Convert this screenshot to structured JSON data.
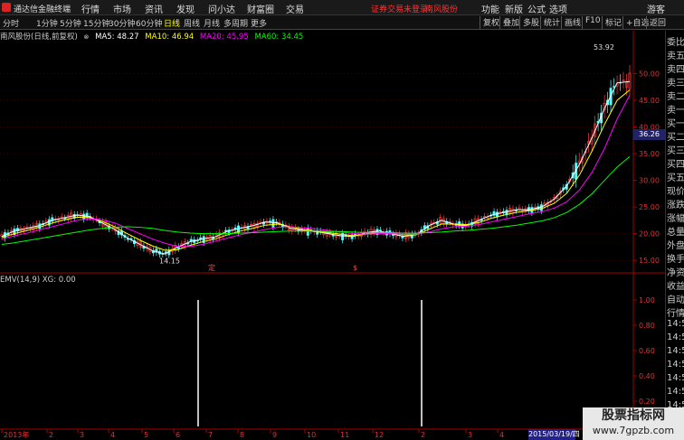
{
  "menubar": {
    "app_title": "通达信金融终端",
    "items": [
      "行情",
      "市场",
      "资讯",
      "发现",
      "问小达",
      "财富圈",
      "交易"
    ],
    "alert": "证券交易未登录",
    "stock_alert": "南风股份",
    "right_items": [
      "功能",
      "新版",
      "公式",
      "选项"
    ],
    "user": "游客"
  },
  "toolbar": {
    "periods": [
      "分时",
      "1分钟",
      "5分钟",
      "15分钟",
      "30分钟",
      "60分钟",
      "日线",
      "周线",
      "月线",
      "多周期",
      "更多"
    ],
    "active_period": "日线",
    "right_buttons": [
      "复权",
      "叠加",
      "多股",
      "统计",
      "画线",
      "F10",
      "标记",
      "+自选",
      "返回"
    ]
  },
  "chart_header": {
    "stock": "南风股份(日线,前复权)",
    "ma5": "MA5: 48.27",
    "ma10": "MA10: 46.94",
    "ma20": "MA20: 45.95",
    "ma60": "MA60: 34.45",
    "colors": {
      "ma5": "#ffffff",
      "ma10": "#ffff00",
      "ma20": "#ff00ff",
      "ma60": "#00ff00",
      "stock": "#cccccc"
    }
  },
  "emv_header": {
    "label": "EMV(14,9)",
    "xg": "XG: 0.00"
  },
  "right_panel": [
    "委比",
    "卖五",
    "卖四",
    "卖三",
    "卖二",
    "卖一",
    "买一",
    "买二",
    "买三",
    "买四",
    "买五",
    "现价",
    "涨跌",
    "涨幅",
    "总量",
    "外盘",
    "换手",
    "净资",
    "收益",
    "自动",
    "行情",
    "14:5(",
    "14:5(",
    "14:5(",
    "14:5(",
    "14:5(",
    "14:5(",
    "14:5(",
    "14:5("
  ],
  "price_axis_labels": [
    "50.00",
    "45.00",
    "40.00",
    "35.00",
    "30.00",
    "25.00",
    "20.00",
    "15.00"
  ],
  "emv_axis_labels": [
    "1.00",
    "0.80",
    "0.60",
    "0.40",
    "0.20"
  ],
  "x_axis_labels": [
    "2013年",
    "2",
    "3",
    "4",
    "5",
    "6",
    "7",
    "8",
    "9",
    "10",
    "11",
    "12",
    "2",
    "3",
    "4",
    "5"
  ],
  "annotations": {
    "high": "53.92",
    "low": "14.15",
    "current": "36.26",
    "marker1": "定",
    "marker2": "$"
  },
  "date_badge": "2015/03/19/四",
  "watermark": {
    "line1": "股票指标网",
    "line2": "www.7gpzb.com"
  },
  "chart_data": [
    {
      "type": "line",
      "title": "南风股份(日线,前复权)",
      "ylim": [
        13,
        56
      ],
      "series": [
        {
          "name": "MA5",
          "color": "#ffffff",
          "values": [
            19.5,
            20.5,
            21.0,
            21.5,
            22.5,
            23.0,
            23.5,
            23.2,
            22.0,
            20.8,
            19.2,
            18.0,
            16.8,
            16.2,
            17.5,
            18.5,
            19.0,
            19.4,
            20.5,
            21.0,
            21.5,
            22.2,
            22.0,
            21.0,
            20.6,
            20.4,
            20.0,
            19.6,
            19.5,
            20.2,
            20.5,
            20.0,
            19.5,
            19.8,
            21.5,
            22.5,
            21.8,
            21.5,
            22.5,
            23.5,
            24.0,
            24.5,
            24.5,
            25.0,
            26.5,
            29.0,
            33.0,
            38.0,
            43.5,
            48.27,
            48.5
          ]
        },
        {
          "name": "MA10",
          "color": "#ffff00",
          "values": [
            19.3,
            20.0,
            20.6,
            21.2,
            22.0,
            22.6,
            23.1,
            23.0,
            22.3,
            21.3,
            20.0,
            18.8,
            17.7,
            16.9,
            17.0,
            17.8,
            18.5,
            19.0,
            19.8,
            20.5,
            21.0,
            21.6,
            21.8,
            21.3,
            20.8,
            20.5,
            20.2,
            19.9,
            19.6,
            19.9,
            20.2,
            20.1,
            19.8,
            19.8,
            20.8,
            21.8,
            21.8,
            21.7,
            22.1,
            22.9,
            23.5,
            24.0,
            24.3,
            24.7,
            25.7,
            27.6,
            31.0,
            35.5,
            40.5,
            45.0,
            46.94
          ]
        },
        {
          "name": "MA20",
          "color": "#ff00ff",
          "values": [
            19.0,
            19.6,
            20.1,
            20.7,
            21.3,
            21.9,
            22.5,
            22.8,
            22.6,
            22.0,
            21.0,
            20.0,
            19.0,
            18.2,
            17.6,
            17.6,
            18.0,
            18.6,
            19.2,
            19.8,
            20.3,
            20.8,
            21.2,
            21.3,
            21.1,
            20.9,
            20.6,
            20.3,
            20.0,
            19.9,
            20.0,
            20.0,
            19.9,
            19.9,
            20.3,
            20.9,
            21.3,
            21.4,
            21.7,
            22.2,
            22.7,
            23.2,
            23.7,
            24.1,
            24.8,
            26.0,
            28.2,
            31.5,
            36.0,
            41.5,
            45.95
          ]
        },
        {
          "name": "MA60",
          "color": "#00ff00",
          "values": [
            18.0,
            18.3,
            18.7,
            19.1,
            19.5,
            19.9,
            20.3,
            20.7,
            21.0,
            21.2,
            21.3,
            21.2,
            21.0,
            20.6,
            20.3,
            20.1,
            20.0,
            20.0,
            20.0,
            20.1,
            20.2,
            20.3,
            20.4,
            20.5,
            20.5,
            20.5,
            20.4,
            20.4,
            20.3,
            20.2,
            20.2,
            20.2,
            20.1,
            20.1,
            20.2,
            20.3,
            20.5,
            20.6,
            20.8,
            21.0,
            21.3,
            21.6,
            22.0,
            22.4,
            23.0,
            24.0,
            25.5,
            27.5,
            30.0,
            32.5,
            34.45
          ]
        }
      ]
    },
    {
      "type": "line",
      "title": "EMV(14,9)",
      "ylim": [
        0,
        1.1
      ],
      "series": [
        {
          "name": "XG",
          "color": "#ffffff",
          "values": [
            0,
            0,
            0,
            0,
            0,
            0,
            0,
            0,
            0,
            0,
            0,
            0,
            0,
            0,
            0,
            0,
            0,
            0,
            0,
            0,
            0,
            0,
            1,
            0,
            0,
            0,
            0,
            0,
            0,
            0,
            0,
            0,
            0,
            0,
            0,
            0,
            0,
            0,
            0,
            0,
            0,
            0,
            0,
            0,
            0,
            0,
            0,
            0,
            0,
            0,
            0
          ]
        }
      ]
    }
  ]
}
